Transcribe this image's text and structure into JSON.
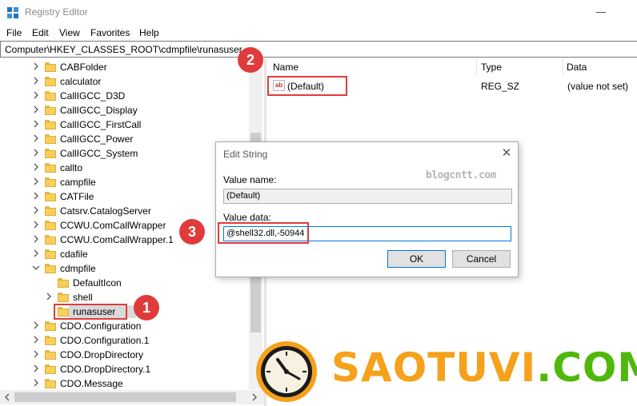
{
  "window": {
    "title": "Registry Editor"
  },
  "menu": [
    "File",
    "Edit",
    "View",
    "Favorites",
    "Help"
  ],
  "address": "Computer\\HKEY_CLASSES_ROOT\\cdmpfile\\runasuser",
  "tree": [
    {
      "label": "CABFolder",
      "expandable": true
    },
    {
      "label": "calculator",
      "expandable": true
    },
    {
      "label": "CallIGCC_D3D",
      "expandable": true
    },
    {
      "label": "CallIGCC_Display",
      "expandable": true
    },
    {
      "label": "CallIGCC_FirstCall",
      "expandable": true
    },
    {
      "label": "CallIGCC_Power",
      "expandable": true
    },
    {
      "label": "CallIGCC_System",
      "expandable": true
    },
    {
      "label": "callto",
      "expandable": true
    },
    {
      "label": "campfile",
      "expandable": true
    },
    {
      "label": "CATFile",
      "expandable": true
    },
    {
      "label": "Catsrv.CatalogServer",
      "expandable": true
    },
    {
      "label": "CCWU.ComCallWrapper",
      "expandable": true
    },
    {
      "label": "CCWU.ComCallWrapper.1",
      "expandable": true
    },
    {
      "label": "cdafile",
      "expandable": true
    },
    {
      "label": "cdmpfile",
      "expandable": true,
      "expanded": true
    },
    {
      "label": "DefaultIcon",
      "child": true
    },
    {
      "label": "shell",
      "child": true,
      "expandable": true
    },
    {
      "label": "runasuser",
      "child": true,
      "selected": true
    },
    {
      "label": "CDO.Configuration",
      "expandable": true
    },
    {
      "label": "CDO.Configuration.1",
      "expandable": true
    },
    {
      "label": "CDO.DropDirectory",
      "expandable": true
    },
    {
      "label": "CDO.DropDirectory.1",
      "expandable": true
    },
    {
      "label": "CDO.Message",
      "expandable": true
    }
  ],
  "list": {
    "headers": {
      "name": "Name",
      "type": "Type",
      "data": "Data"
    },
    "rows": [
      {
        "icon": "ab",
        "name": "(Default)",
        "type": "REG_SZ",
        "data": "(value not set)"
      }
    ]
  },
  "dialog": {
    "title": "Edit String",
    "close_glyph": "✕",
    "value_name_label": "Value name:",
    "value_name": "(Default)",
    "value_data_label": "Value data:",
    "value_data": "@shell32.dll,-50944",
    "ok": "OK",
    "cancel": "Cancel",
    "watermark": "blogcntt.com"
  },
  "callouts": [
    "1",
    "2",
    "3"
  ],
  "brand": {
    "text_orange": "SAOTUVI",
    "text_green": ".COM",
    "colors": {
      "orange": "#f5a11b",
      "green": "#4fb80b",
      "clock_outer": "#f5a11b",
      "clock_face": "#f6f1e1"
    }
  },
  "colors": {
    "callout": "#e03b3b",
    "focus": "#0078d7",
    "folder": "#f7cf5a"
  }
}
